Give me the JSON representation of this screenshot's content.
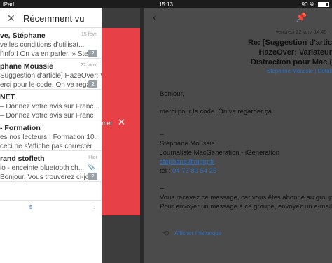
{
  "status_bar": {
    "device": "iPad",
    "time": "15:13",
    "battery": "90 %"
  },
  "recent": {
    "title": "Récemment vu",
    "items": [
      {
        "sender": "ve, Stéphane",
        "date": "15 févr.",
        "line2": "velles conditions d'utilisat...",
        "line3": "l'info ! On va en parler. » Ste",
        "badge": "2"
      },
      {
        "sender": "phane Moussie",
        "date": "22 janv.",
        "line2": "Suggestion d'article] HazeOver: Vari...",
        "line3": "erci pour le code. On va regar",
        "badge": "2"
      },
      {
        "sender": "NET",
        "date": "",
        "line2": "– Donnez votre avis sur Franc...",
        "line3": "– Donnez votre avis sur Franc",
        "badge": ""
      },
      {
        "sender": "- Formation",
        "date": "",
        "line2": "es nos lecteurs ! Formation 10...",
        "line3": "ceci ne s'affiche pas correcter",
        "badge": ""
      },
      {
        "sender": "rand stofleth",
        "date": "Hier",
        "line2": "io - enceinte bluetooth ch...",
        "line3": "Bonjour, Vous trouverez ci-jo",
        "badge": "2"
      }
    ],
    "footer_count": "5"
  },
  "swipe": {
    "label": "mer"
  },
  "email": {
    "date": "vendredi 22 janv. 14:46",
    "subject_lines": [
      "Re: [Suggestion d'artic",
      "HazeOver: Variateur",
      "Distraction pour Mac (",
      "Stéphane Moussie | Détail"
    ],
    "from": "Stéphane Moussie | Détail",
    "body": {
      "greeting": "Bonjour,",
      "line1": "merci pour le code. On va regarder ça.",
      "sep1": "--",
      "sig_name": "Stéphane Moussie",
      "sig_role": "Journaliste MacGeneration - iGeneration",
      "sig_email": "stephane@mgig.fr",
      "sig_tel_label": "tél :",
      "sig_tel": "04 72 80 54 25",
      "sep2": "--",
      "notice1": "Vous recevez ce message, car vous êtes abonné au group",
      "notice2": "Pour envoyer un message à ce groupe, envoyez un e-mail"
    },
    "history_label": "Afficher l'historique"
  }
}
